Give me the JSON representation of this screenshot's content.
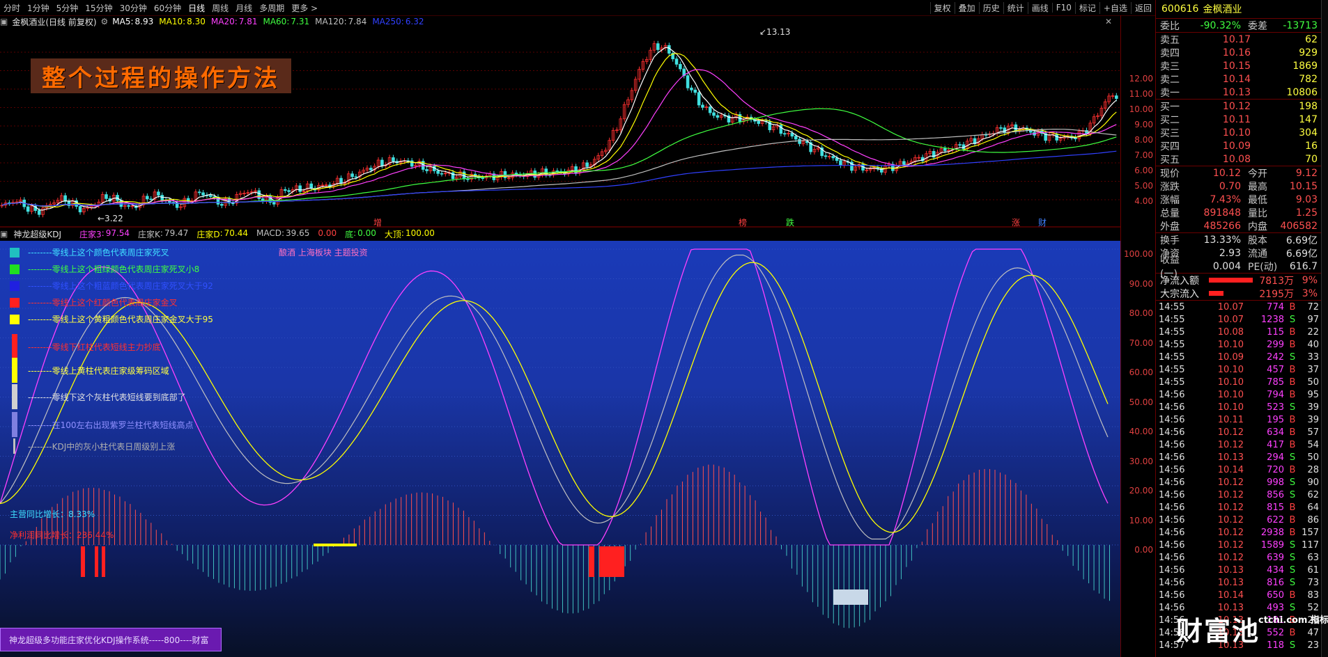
{
  "toolbar": {
    "periods": [
      "分时",
      "1分钟",
      "5分钟",
      "15分钟",
      "30分钟",
      "60分钟",
      "日线",
      "周线",
      "月线",
      "多周期",
      "更多 >"
    ],
    "active_period": "日线",
    "right_buttons": [
      "复权",
      "叠加",
      "历史",
      "统计",
      "画线",
      "F10",
      "标记",
      "+自选",
      "返回"
    ]
  },
  "price_panel": {
    "stock_label": "金枫酒业(日线 前复权)",
    "ma": [
      {
        "name": "MA5",
        "value": "8.93",
        "color": "#ffffff"
      },
      {
        "name": "MA10",
        "value": "8.30",
        "color": "#ffff00"
      },
      {
        "name": "MA20",
        "value": "7.81",
        "color": "#ff40ff"
      },
      {
        "name": "MA60",
        "value": "7.31",
        "color": "#40ff40"
      },
      {
        "name": "MA120",
        "value": "7.84",
        "color": "#c0c0c0"
      },
      {
        "name": "MA250",
        "value": "6.32",
        "color": "#3040ff"
      }
    ],
    "overlay_title": "整个过程的操作方法",
    "high_label": "13.13",
    "low_label": "3.22",
    "markers": [
      {
        "text": "增",
        "color": "#ff4040"
      },
      {
        "text": "榜",
        "color": "#ff4040"
      },
      {
        "text": "跌",
        "color": "#40ff40"
      },
      {
        "text": "涨",
        "color": "#ff4040"
      },
      {
        "text": "财",
        "color": "#4080ff"
      }
    ],
    "y_ticks": [
      "12.00",
      "11.00",
      "10.00",
      "9.00",
      "8.00",
      "7.00",
      "6.00",
      "5.00",
      "4.00"
    ]
  },
  "indicator": {
    "name": "神龙超级KDJ",
    "values": [
      {
        "label": "庄家3",
        "value": "97.54",
        "color": "#ff40ff"
      },
      {
        "label": "庄家K",
        "value": "79.47",
        "color": "#c0c0c0"
      },
      {
        "label": "庄家D",
        "value": "70.44",
        "color": "#ffff00"
      },
      {
        "label": "MACD",
        "value": "39.65",
        "color": "#c0c0c0"
      },
      {
        "label": "",
        "value": "0.00",
        "color": "#ff4040"
      },
      {
        "label": "底",
        "value": "0.00",
        "color": "#40ff40"
      },
      {
        "label": "大顶",
        "value": "100.00",
        "color": "#ffff00"
      }
    ],
    "theme_text": "酿酒 上海板块 主题投资",
    "legend": [
      {
        "color": "#20c0c0",
        "shape": "square",
        "text": "--------零线上这个颜色代表周庄家死叉",
        "text_color": "#40e0ff"
      },
      {
        "color": "#20e020",
        "shape": "square",
        "text": "--------零线上这个粗绿颜色代表周庄家死叉小8",
        "text_color": "#40ff40"
      },
      {
        "color": "#2020e0",
        "shape": "square",
        "text": "--------零线上这个粗蓝颜色代表周庄家死叉大于92",
        "text_color": "#3050ff"
      },
      {
        "color": "#ff2020",
        "shape": "square",
        "text": "--------零线上这个红颜色代表周庄家金叉",
        "text_color": "#ff3030"
      },
      {
        "color": "#ffff00",
        "shape": "square",
        "text": "--------零线上这个黄粗颜色代表周庄家金叉大于95",
        "text_color": "#ffff40"
      },
      {
        "color": "#ff2020",
        "shape": "bar",
        "text": "--------零线下红柱代表短线主力抄底",
        "text_color": "#ff3030"
      },
      {
        "color": "#ffff00",
        "shape": "bar",
        "text": "--------零线上黄柱代表庄家级筹码区域",
        "text_color": "#ffff40"
      },
      {
        "color": "#d0d0d0",
        "shape": "bar",
        "text": "--------零线下这个灰柱代表短线要到底部了",
        "text_color": "#e0e0e0"
      },
      {
        "color": "#8080e0",
        "shape": "bar",
        "text": "--------在100左右出现紫罗兰柱代表短线高点",
        "text_color": "#9090ff"
      },
      {
        "color": "#c0c0c0",
        "shape": "thin",
        "text": "--------KDJ中的灰小柱代表日周级别上涨",
        "text_color": "#b0b0b0"
      }
    ],
    "main_growth": "主营同比增长：8.33%",
    "profit_growth": "净利润同比增长：236.44%",
    "bottom_label": "神龙超级多功能庄家优化KDJ操作系统-----800----财富",
    "y_ticks": [
      "100.00",
      "90.00",
      "80.00",
      "70.00",
      "60.00",
      "50.00",
      "40.00",
      "30.00",
      "20.00",
      "10.00",
      "0.00"
    ]
  },
  "quote_panel": {
    "code": "600616",
    "name": "金枫酒业",
    "ratio": {
      "label1": "委比",
      "v1": "-90.32%",
      "label2": "委差",
      "v2": "-13713"
    },
    "asks": [
      {
        "label": "卖五",
        "price": "10.17",
        "vol": "62"
      },
      {
        "label": "卖四",
        "price": "10.16",
        "vol": "929"
      },
      {
        "label": "卖三",
        "price": "10.15",
        "vol": "1869"
      },
      {
        "label": "卖二",
        "price": "10.14",
        "vol": "782"
      },
      {
        "label": "卖一",
        "price": "10.13",
        "vol": "10806"
      }
    ],
    "bids": [
      {
        "label": "买一",
        "price": "10.12",
        "vol": "198"
      },
      {
        "label": "买二",
        "price": "10.11",
        "vol": "147"
      },
      {
        "label": "买三",
        "price": "10.10",
        "vol": "304"
      },
      {
        "label": "买四",
        "price": "10.09",
        "vol": "16"
      },
      {
        "label": "买五",
        "price": "10.08",
        "vol": "70"
      }
    ],
    "stats": [
      {
        "k": "现价",
        "v": "10.12",
        "k2": "今开",
        "v2": "9.12"
      },
      {
        "k": "涨跌",
        "v": "0.70",
        "k2": "最高",
        "v2": "10.15"
      },
      {
        "k": "涨幅",
        "v": "7.43%",
        "k2": "最低",
        "v2": "9.03"
      },
      {
        "k": "总量",
        "v": "891848",
        "k2": "量比",
        "v2": "1.25"
      },
      {
        "k": "外盘",
        "v": "485266",
        "k2": "内盘",
        "v2": "406582"
      }
    ],
    "stats2": [
      {
        "k": "换手",
        "v": "13.33%",
        "k2": "股本",
        "v2": "6.69亿"
      },
      {
        "k": "净资",
        "v": "2.93",
        "k2": "流通",
        "v2": "6.69亿"
      },
      {
        "k": "收益(一)",
        "v": "0.004",
        "k2": "PE(动)",
        "v2": "616.7"
      }
    ],
    "flows": [
      {
        "k": "净流入额",
        "v": "7813万",
        "p": "9%",
        "bar": 0.9
      },
      {
        "k": "大宗流入",
        "v": "2195万",
        "p": "3%",
        "bar": 0.3
      }
    ],
    "trades": [
      {
        "t": "14:55",
        "p": "10.07",
        "v": "774",
        "s": "B",
        "n": "72"
      },
      {
        "t": "14:55",
        "p": "10.07",
        "v": "1238",
        "s": "S",
        "n": "97"
      },
      {
        "t": "14:55",
        "p": "10.08",
        "v": "115",
        "s": "B",
        "n": "22"
      },
      {
        "t": "14:55",
        "p": "10.10",
        "v": "299",
        "s": "B",
        "n": "40"
      },
      {
        "t": "14:55",
        "p": "10.09",
        "v": "242",
        "s": "S",
        "n": "33"
      },
      {
        "t": "14:55",
        "p": "10.10",
        "v": "457",
        "s": "B",
        "n": "37"
      },
      {
        "t": "14:55",
        "p": "10.10",
        "v": "785",
        "s": "B",
        "n": "50"
      },
      {
        "t": "14:56",
        "p": "10.10",
        "v": "794",
        "s": "B",
        "n": "95"
      },
      {
        "t": "14:56",
        "p": "10.10",
        "v": "523",
        "s": "S",
        "n": "39"
      },
      {
        "t": "14:56",
        "p": "10.11",
        "v": "195",
        "s": "B",
        "n": "39"
      },
      {
        "t": "14:56",
        "p": "10.12",
        "v": "634",
        "s": "B",
        "n": "57"
      },
      {
        "t": "14:56",
        "p": "10.12",
        "v": "417",
        "s": "B",
        "n": "54"
      },
      {
        "t": "14:56",
        "p": "10.13",
        "v": "294",
        "s": "S",
        "n": "50"
      },
      {
        "t": "14:56",
        "p": "10.14",
        "v": "720",
        "s": "B",
        "n": "28"
      },
      {
        "t": "14:56",
        "p": "10.12",
        "v": "998",
        "s": "S",
        "n": "90"
      },
      {
        "t": "14:56",
        "p": "10.12",
        "v": "856",
        "s": "S",
        "n": "62"
      },
      {
        "t": "14:56",
        "p": "10.12",
        "v": "815",
        "s": "B",
        "n": "64"
      },
      {
        "t": "14:56",
        "p": "10.12",
        "v": "622",
        "s": "B",
        "n": "86"
      },
      {
        "t": "14:56",
        "p": "10.12",
        "v": "2938",
        "s": "B",
        "n": "157"
      },
      {
        "t": "14:56",
        "p": "10.12",
        "v": "1589",
        "s": "S",
        "n": "117"
      },
      {
        "t": "14:56",
        "p": "10.12",
        "v": "639",
        "s": "S",
        "n": "63"
      },
      {
        "t": "14:56",
        "p": "10.13",
        "v": "434",
        "s": "S",
        "n": "61"
      },
      {
        "t": "14:56",
        "p": "10.13",
        "v": "816",
        "s": "S",
        "n": "73"
      },
      {
        "t": "14:56",
        "p": "10.14",
        "v": "650",
        "s": "B",
        "n": "83"
      },
      {
        "t": "14:56",
        "p": "10.13",
        "v": "493",
        "s": "S",
        "n": "52"
      },
      {
        "t": "14:56",
        "p": "10.13",
        "v": "181",
        "s": "B",
        "n": "20"
      },
      {
        "t": "14:56",
        "p": "10.13",
        "v": "552",
        "s": "B",
        "n": "47"
      },
      {
        "t": "14:57",
        "p": "10.13",
        "v": "118",
        "s": "S",
        "n": "23"
      }
    ],
    "watermark": "财富池",
    "watermark_small": "ctchi.com 指标交易平台"
  }
}
